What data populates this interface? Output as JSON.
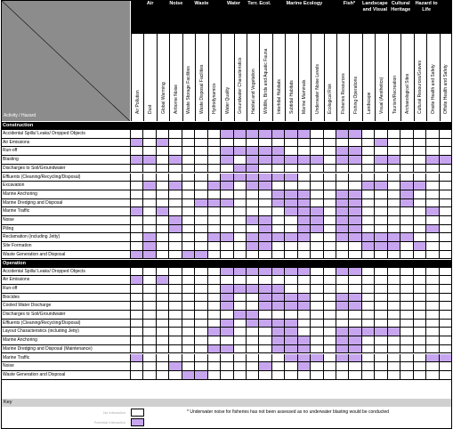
{
  "corner_label": "Activity / Hazard",
  "categories": [
    {
      "label": "Air",
      "span": 3
    },
    {
      "label": "Noise",
      "span": 1
    },
    {
      "label": "Waste",
      "span": 3
    },
    {
      "label": "Water",
      "span": 2
    },
    {
      "label": "Terr. Ecol.",
      "span": 2
    },
    {
      "label": "Marine Ecology",
      "span": 5
    },
    {
      "label": "Fish*",
      "span": 2
    },
    {
      "label": "Landscape and Visual",
      "span": 2
    },
    {
      "label": "Cultural Heritage",
      "span": 2
    },
    {
      "label": "Hazard to Life",
      "span": 2
    }
  ],
  "columns": [
    "Air Pollution",
    "Dust",
    "Global Warming",
    "Airborne Noise",
    "Waste Storage Facilities",
    "Waste Disposal Facilities",
    "Hydrodynamics",
    "Water Quality",
    "Groundwater Characteristics",
    "Habitat and Vegetation",
    "Wildlife, Birds and Aquatic Fauna",
    "Intertidal Habitats",
    "Subtidal Habitats",
    "Marine Mammals",
    "Underwater Noise Levels",
    "Ecological Risk",
    "Fisheries Resources",
    "Fishing Operations",
    "Landscape",
    "Visual (Aesthetics)",
    "Tourism/Recreation",
    "Archaeological Sites",
    "Cultural Resources/Graves",
    "Onsite Health and Safety",
    "Offsite Health and Safety"
  ],
  "sections": [
    {
      "title": "Construction",
      "rows": [
        {
          "label": "Accidental Spills/ Leaks/ Dropped Objects",
          "on": [
            7,
            8,
            9,
            10,
            11,
            12,
            13,
            16,
            17
          ]
        },
        {
          "label": "Air Emissions",
          "on": [
            0,
            2,
            19
          ]
        },
        {
          "label": "Run-off",
          "on": [
            7,
            8,
            9,
            10,
            11,
            16,
            17
          ]
        },
        {
          "label": "Blasting",
          "on": [
            0,
            1,
            3,
            7,
            9,
            10,
            11,
            12,
            13,
            14,
            16,
            17,
            19,
            20,
            23,
            24
          ]
        },
        {
          "label": "Discharges to Soil/Groundwater",
          "on": [
            8,
            9
          ]
        },
        {
          "label": "Effluents (Cleaning/Recycling/Disposal)",
          "on": [
            7,
            8,
            9,
            10,
            11,
            12
          ]
        },
        {
          "label": "Excavation",
          "on": [
            1,
            3,
            6,
            7,
            9,
            10,
            18,
            19,
            21,
            22
          ]
        },
        {
          "label": "Marine Anchoring",
          "on": [
            11,
            12,
            13,
            16,
            17,
            21
          ]
        },
        {
          "label": "Marine Dredging and Disposal",
          "on": [
            5,
            6,
            7,
            11,
            12,
            13,
            16,
            17,
            21
          ]
        },
        {
          "label": "Marine Traffic",
          "on": [
            0,
            2,
            12,
            13,
            14,
            16,
            17,
            23
          ]
        },
        {
          "label": "Noise",
          "on": [
            3,
            9,
            10,
            13,
            14,
            16,
            17
          ]
        },
        {
          "label": "Piling",
          "on": [
            3,
            10,
            13,
            14,
            16,
            17,
            23
          ]
        },
        {
          "label": "Reclamation (including Jetty)",
          "on": [
            1,
            6,
            7,
            9,
            10,
            11,
            12,
            13,
            16,
            17,
            18,
            19,
            20,
            21
          ]
        },
        {
          "label": "Site Formation",
          "on": [
            1,
            9,
            10,
            18,
            19,
            20,
            22
          ]
        },
        {
          "label": "Waste Generation and Disposal",
          "on": [
            0,
            1,
            4,
            5
          ]
        }
      ]
    },
    {
      "title": "Operation",
      "rows": [
        {
          "label": "Accidental Spills/ Leaks/ Dropped Objects",
          "on": [
            7,
            8,
            9,
            10,
            11,
            12,
            13,
            16,
            17
          ]
        },
        {
          "label": "Air Emissions",
          "on": [
            0,
            2
          ]
        },
        {
          "label": "Run-off",
          "on": [
            7,
            8,
            9,
            10,
            11
          ]
        },
        {
          "label": "Biocides",
          "on": [
            7,
            10,
            11,
            12,
            13,
            16,
            17
          ]
        },
        {
          "label": "Cooled Water Discharge",
          "on": [
            7,
            10,
            11,
            12,
            13,
            16,
            17
          ]
        },
        {
          "label": "Discharges to Soil/Groundwater",
          "on": [
            8,
            9
          ]
        },
        {
          "label": "Effluents (Cleaning/Recycling/Disposal)",
          "on": [
            7,
            9,
            10,
            11,
            12
          ]
        },
        {
          "label": "Layout Characteristics (including Jetty)",
          "on": [
            6,
            7,
            11,
            12,
            16,
            17,
            18,
            19,
            20
          ]
        },
        {
          "label": "Marine Anchoring",
          "on": [
            11,
            12,
            13,
            16,
            17
          ]
        },
        {
          "label": "Marine Dredging and Disposal (Maintenance)",
          "on": [
            6,
            7,
            11,
            12,
            13,
            16,
            17
          ]
        },
        {
          "label": "Marine Traffic",
          "on": [
            0,
            12,
            13,
            14,
            16,
            17,
            23,
            24
          ]
        },
        {
          "label": "Noise",
          "on": [
            3,
            10,
            13
          ]
        },
        {
          "label": "Waste Generation and Disposal",
          "on": [
            4,
            5
          ]
        }
      ]
    }
  ],
  "key": {
    "title": "Key",
    "no_interaction": "No Interaction",
    "potential_interaction": "Potential Interaction",
    "footnote": "* Underwater noise for fisheries has not been assessed as no underwater blasting would be conducted"
  },
  "colors": {
    "interaction": "#c7a6ef",
    "header": "#000000",
    "corner": "#8c8c8c"
  }
}
